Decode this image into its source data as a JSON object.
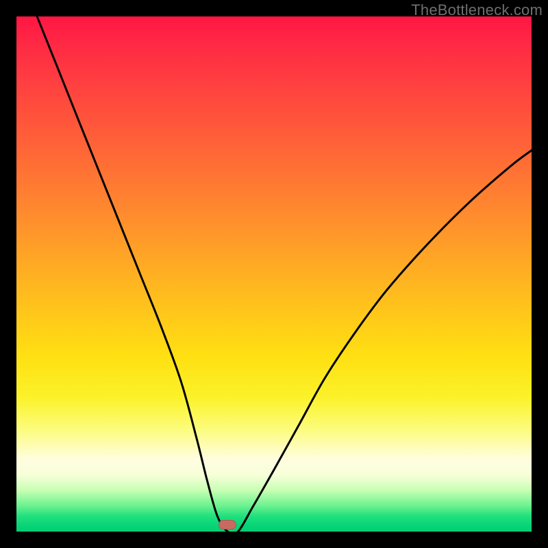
{
  "watermark": "TheBottleneck.com",
  "marker": {
    "x_pct": 41,
    "y_pct": 99
  },
  "chart_data": {
    "type": "line",
    "title": "",
    "xlabel": "",
    "ylabel": "",
    "xlim": [
      0,
      100
    ],
    "ylim": [
      0,
      100
    ],
    "grid": false,
    "legend": false,
    "series": [
      {
        "name": "bottleneck-curve",
        "x": [
          4,
          8,
          12,
          16,
          20,
          24,
          28,
          32,
          35,
          37,
          39,
          41,
          43,
          46,
          50,
          55,
          60,
          66,
          72,
          80,
          88,
          96,
          100
        ],
        "y": [
          100,
          90,
          80,
          70,
          60,
          50,
          40,
          29,
          18,
          10,
          3,
          0,
          0,
          5,
          12,
          21,
          30,
          39,
          47,
          56,
          64,
          71,
          74
        ]
      }
    ],
    "annotations": [
      {
        "type": "marker",
        "shape": "rounded-rect",
        "x": 41,
        "y": 0,
        "color": "#c96a60"
      }
    ],
    "background_gradient": {
      "direction": "vertical",
      "stops": [
        {
          "pos": 0.0,
          "color": "#ff1643"
        },
        {
          "pos": 0.38,
          "color": "#ff8a2e"
        },
        {
          "pos": 0.66,
          "color": "#ffe012"
        },
        {
          "pos": 0.86,
          "color": "#fffde0"
        },
        {
          "pos": 0.97,
          "color": "#21e07e"
        },
        {
          "pos": 1.0,
          "color": "#04cf74"
        }
      ]
    }
  }
}
